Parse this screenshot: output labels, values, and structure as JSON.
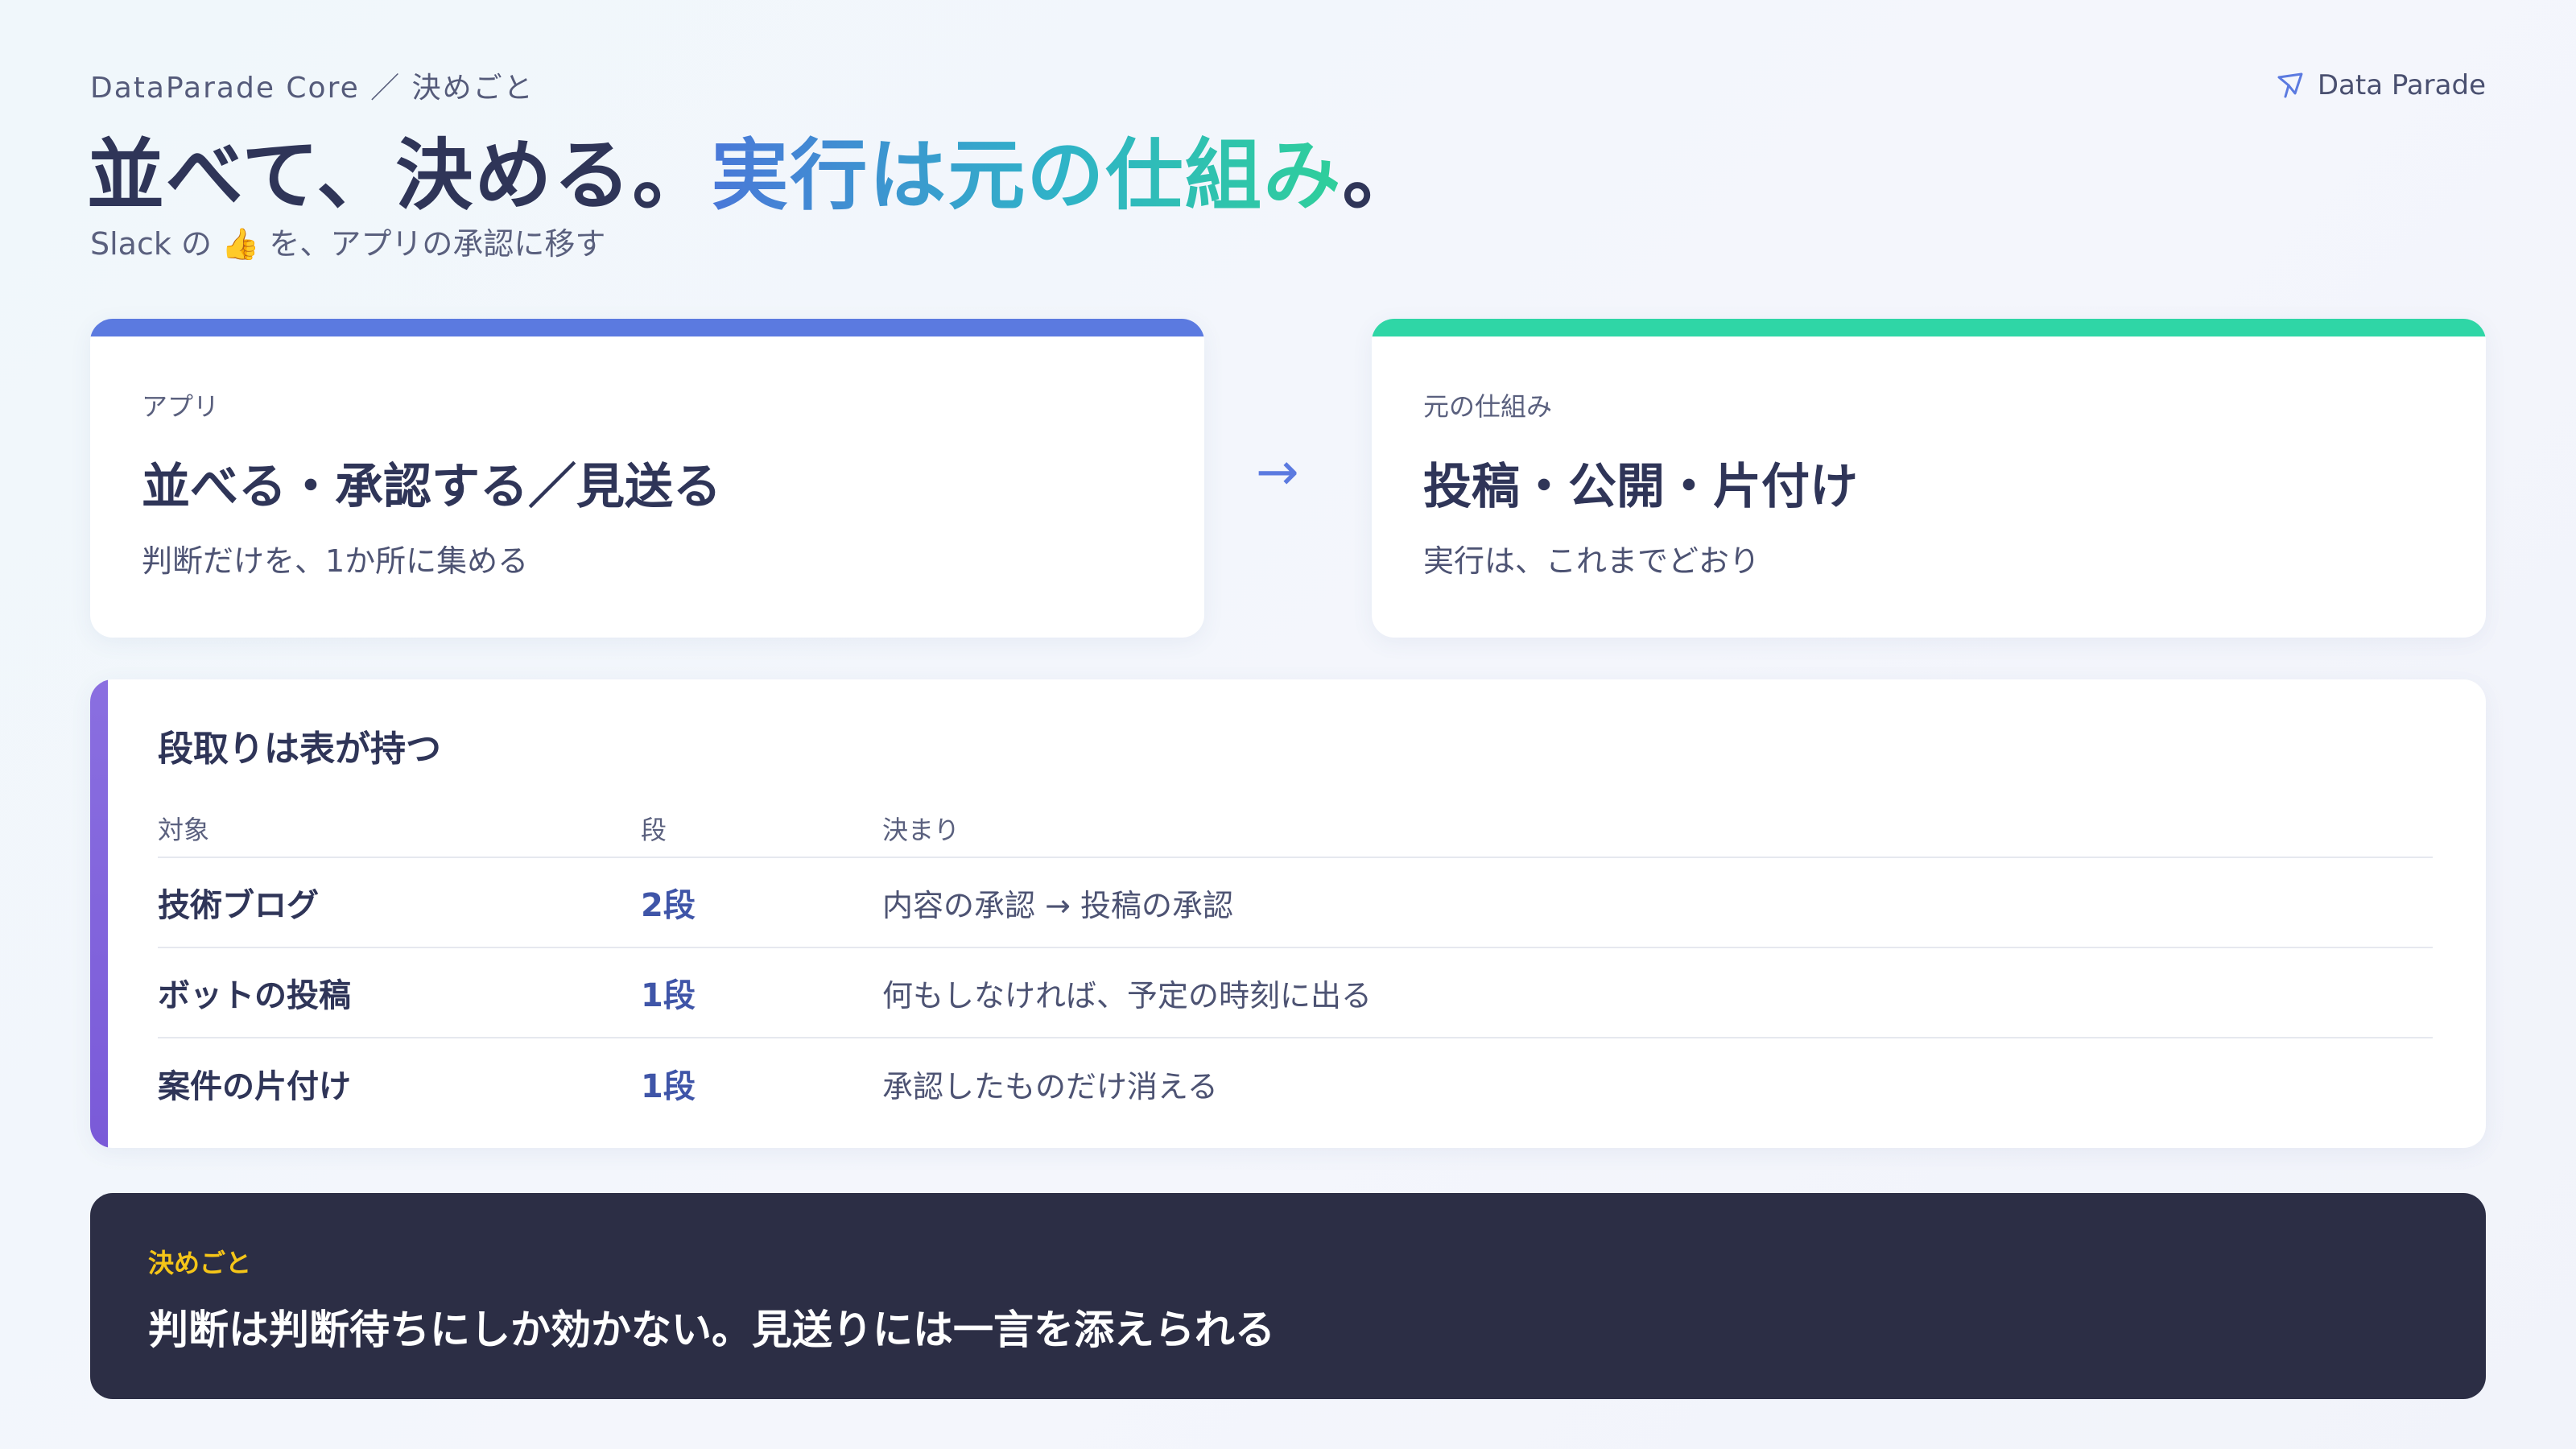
{
  "header": {
    "breadcrumb": "DataParade Core ／ 決めごと",
    "brand": "Data Parade",
    "headline_dark": "並べて、決める。",
    "headline_accent": "実行は元の仕組み",
    "headline_end": "。",
    "subtitle": "Slack の 👍 を、アプリの承認に移す"
  },
  "cards": {
    "left": {
      "eyebrow": "アプリ",
      "title": "並べる・承認する／見送る",
      "desc": "判断だけを、1か所に集める",
      "accent": "#5b7ae0"
    },
    "arrow": "→",
    "right": {
      "eyebrow": "元の仕組み",
      "title": "投稿・公開・片付け",
      "desc": "実行は、これまでどおり",
      "accent": "#2fd6a6"
    }
  },
  "table": {
    "heading": "段取りは表が持つ",
    "columns": [
      "対象",
      "段",
      "決まり"
    ],
    "rows": [
      {
        "target": "技術ブログ",
        "stage": "2段",
        "rule": "内容の承認 → 投稿の承認"
      },
      {
        "target": "ボットの投稿",
        "stage": "1段",
        "rule": "何もしなければ、予定の時刻に出る"
      },
      {
        "target": "案件の片付け",
        "stage": "1段",
        "rule": "承認したものだけ消える"
      }
    ]
  },
  "decision": {
    "tag": "決めごと",
    "text": "判断は判断待ちにしか効かない。見送りには一言を添えられる"
  },
  "colors": {
    "ink": "#2f3558",
    "decision_bg": "#2c2e45",
    "decision_tag": "#f5c518",
    "table_accent": "#7a5ad8"
  }
}
